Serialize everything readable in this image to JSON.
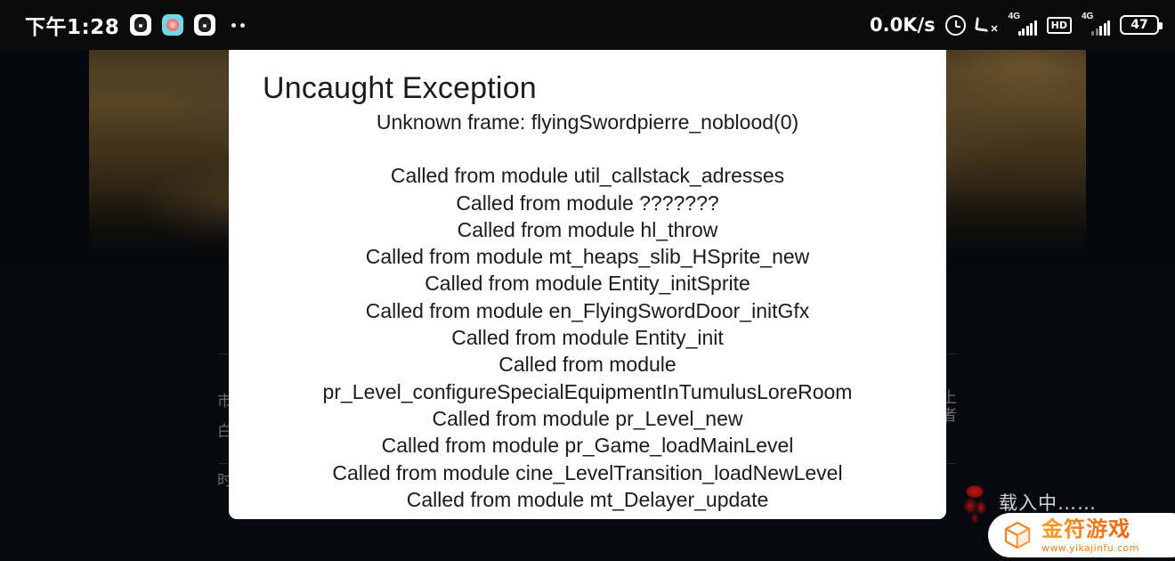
{
  "statusbar": {
    "time": "下午1:28",
    "notification_icons": [
      "qq-app-icon",
      "cyan-app-icon",
      "qq-app-icon"
    ],
    "overflow_indicator": "more-notifications-dots",
    "network_speed": "0.0K/s",
    "alarm_icon": "alarm-clock-icon",
    "mute_call_icon": "phone-silent-icon",
    "sim1_network": "4G",
    "hd_label": "HD",
    "sim2_network": "4G",
    "battery_percent": "47"
  },
  "background": {
    "loading_text": "载入中……",
    "sigil_icon": "red-sigil-icon",
    "hidden_cn_1": "市",
    "hidden_cn_2": "白",
    "hidden_cn_3": "时",
    "hidden_cn_right_1": "上",
    "hidden_cn_right_2": "者"
  },
  "dialog": {
    "title": "Uncaught Exception",
    "subtitle": "Unknown frame: flyingSwordpierre_noblood(0)",
    "stack": [
      "Called from module util_callstack_adresses",
      "Called from module ???????",
      "Called from module hl_throw",
      "Called from module mt_heaps_slib_HSprite_new",
      "Called from module Entity_initSprite",
      "Called from module en_FlyingSwordDoor_initGfx",
      "Called from module Entity_init",
      "Called from module pr_Level_configureSpecialEquipmentInTumulusLoreRoom",
      "Called from module pr_Level_new",
      "Called from module pr_Game_loadMainLevel",
      "Called from module cine_LevelTransition_loadNewLevel",
      "Called from module mt_Delayer_update"
    ]
  },
  "watermark": {
    "logo_icon": "cube-logo-icon",
    "brand": "金符游戏",
    "url": "www.yikajinfu.com"
  },
  "colors": {
    "dialog_bg": "#ffffff",
    "dialog_text": "#1b1b1b",
    "statusbar_bg": "#0b0b0b",
    "brand_orange": "#f5821f",
    "sigil_red": "#b01212"
  }
}
